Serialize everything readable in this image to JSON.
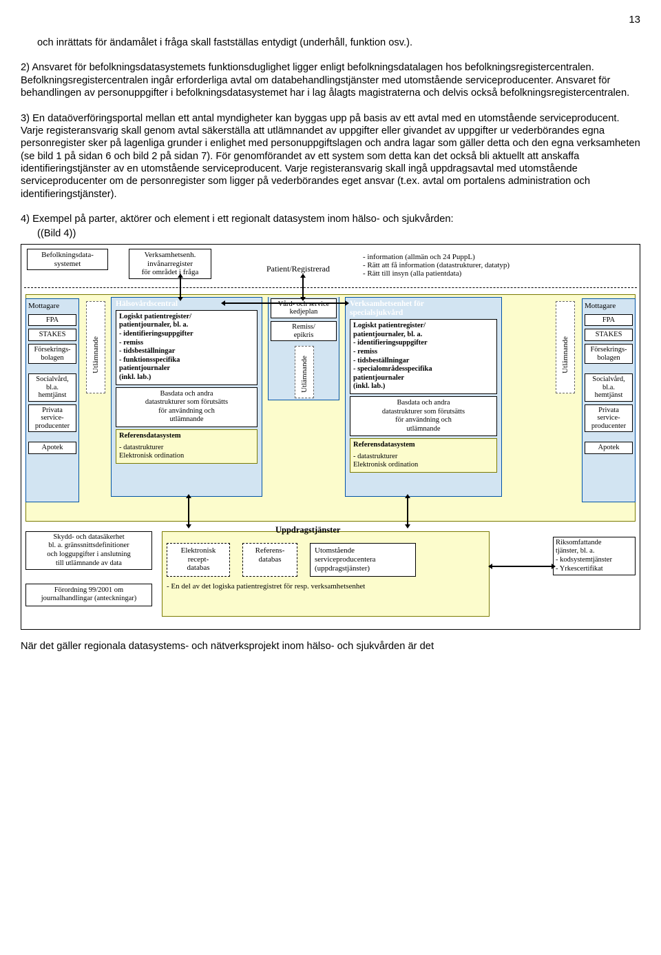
{
  "page_number": "13",
  "paragraphs": {
    "p1": "och inrättats för ändamålet i fråga skall fastställas entydigt (underhåll, funktion osv.).",
    "p2": "2) Ansvaret för befolkningsdatasystemets funktionsduglighet ligger enligt befolkningsdatalagen hos befolkningsregistercentralen. Befolkningsregistercentralen ingår erforderliga avtal om databehandlingstjänster med utomstående serviceproducenter. Ansvaret för behandlingen av personuppgifter i befolkningsdatasystemet har i lag ålagts magistraterna och delvis också befolkningsregistercentralen.",
    "p3": "3) En dataöverföringsportal mellan ett antal myndigheter kan byggas upp på basis av ett avtal med en utomstående serviceproducent. Varje registeransvarig skall genom avtal säkerställa att utlämnandet av uppgifter eller givandet av uppgifter ur vederbörandes egna personregister sker på lagenliga grunder i enlighet med personuppgiftslagen och andra lagar som gäller detta och den egna verksamheten (se bild 1 på sidan 6 och bild 2 på sidan 7). För genomförandet av ett system som detta kan det också bli aktuellt att anskaffa identifieringstjänster av en utomstående serviceproducent. Varje registeransvarig skall ingå uppdragsavtal med utomstående serviceproducenter om de personregister som ligger på vederbörandes eget ansvar (t.ex. avtal om portalens administration och identifieringstjänster).",
    "p4": "4) Exempel på parter, aktörer och element i ett regionalt datasystem inom hälso- och sjukvården:",
    "bild": "(Bild 4)"
  },
  "top": {
    "bds": "Befolkningsdata-\nsystemet",
    "verk": "Verksamhetsenh.\ninvånarregister\nför området i fråga",
    "patient": "Patient/Registrerad",
    "rights": {
      "r1": "- information (allmän och 24 PuppL)",
      "r2": "- Rätt att få information (datastrukturer, datatyp)",
      "r3": "- Rätt till insyn (alla patientdata)"
    }
  },
  "receivers": {
    "title": "Mottagare",
    "fpa": "FPA",
    "stakes": "STAKES",
    "forsek": "Försekrings-\nbolagen",
    "social": "Socialvård,\nbl.a.\nhemtjänst",
    "privat": "Privata service-\nproducenter",
    "apotek": "Apotek",
    "util": "Utlämnande"
  },
  "hvc": {
    "title": "Hälsovårdscentral",
    "block1": "Logiskt patientregister/\npatientjournaler, bl. a.\n- identifieringsuppgifter\n- remiss\n- tidsbeställningar\n- funktionsspecifika\n  patientjournaler\n  (inkl. lab.)",
    "block2": "Basdata och andra\ndatastrukturer som förutsätts\nför användning och\nutlämnande",
    "refs_title": "Referensdatasystem",
    "refs_body": "- datastrukturer\nElektronisk ordination"
  },
  "sjv": {
    "title": "Verksamhetsenhet för\nspecialsjukvård",
    "block1": "Logiskt patientregister/\npatientjournaler, bl. a.\n- identifieringsuppgifter\n- remiss\n- tidsbeställningar\n- specialområdesspecifika\n  patientjournaler\n  (inkl. lab.)",
    "block2": "Basdata och andra\ndatastrukturer som förutsätts\nför användning och\nutlämnande",
    "refs_title": "Referensdatasystem",
    "refs_body": "- datastrukturer\nElektronisk ordination"
  },
  "middle_box": {
    "vard": "Vård- och service\nkedjeplan",
    "remiss": "Remiss/\nepikris",
    "util": "Utlämnande"
  },
  "bottom": {
    "security": "Skydd- och datasäkerhet\nbl. a. gränssnittsdefinitioner\noch loggupgifter i anslutning\ntill utlämnande av data",
    "reg": "Förordning 99/2001 om\njournalhandlingar (anteckningar)",
    "uppdrag_title": "Uppdragstjänster",
    "erecept": "Elektronisk\nrecept-\ndatabas",
    "refdb": "Referens-\ndatabas",
    "utom": "Utomstående\nserviceproducentera\n(uppdragstjänster)",
    "note": "- En del av det logiska patientregistret för resp. verksamhetsenhet",
    "riks": "Riksomfattande\ntjänster, bl. a.\n- kodsystemtjänster\n- Yrkescertifikat"
  },
  "footer": "När det gäller regionala datasystems- och nätverksprojekt inom hälso- och sjukvården är det"
}
